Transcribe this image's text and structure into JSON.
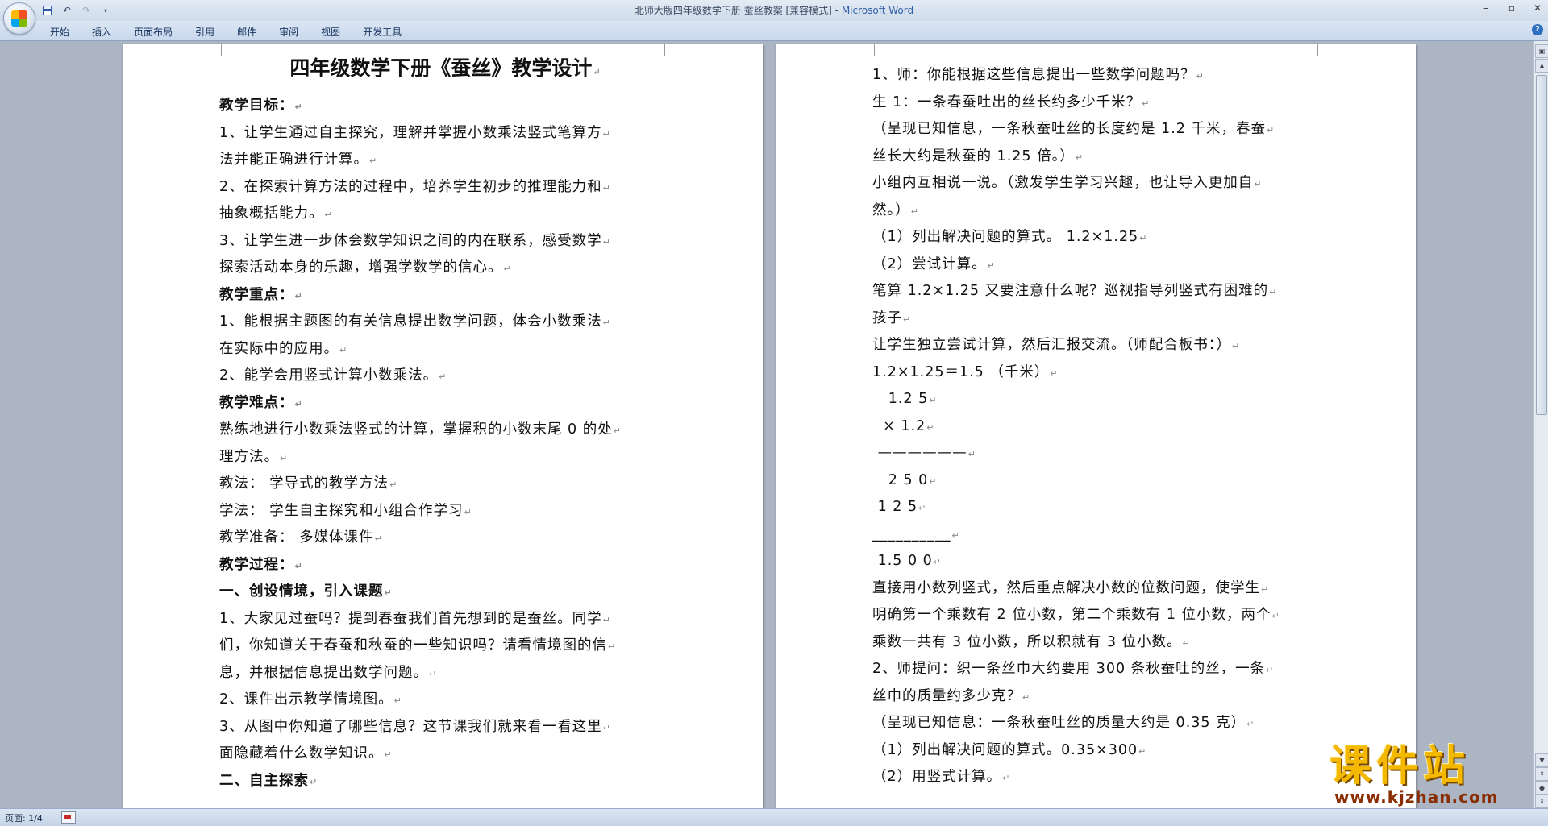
{
  "window": {
    "title": "北师大版四年级数学下册  蚕丝教案 [兼容模式] - ",
    "app_name": "Microsoft Word"
  },
  "qat": {
    "save_icon": "save-icon",
    "undo_icon": "undo-icon",
    "redo_icon": "redo-icon",
    "customize_icon": "dropdown-icon"
  },
  "ribbon": {
    "tabs": [
      "开始",
      "插入",
      "页面布局",
      "引用",
      "邮件",
      "审阅",
      "视图",
      "开发工具"
    ]
  },
  "document": {
    "title": "四年级数学下册《蚕丝》教学设计",
    "left_page": [
      {
        "text": "教学目标：",
        "bold": true
      },
      {
        "text": "1、让学生通过自主探究，理解并掌握小数乘法竖式笔算方"
      },
      {
        "text": "法并能正确进行计算。"
      },
      {
        "text": "2、在探索计算方法的过程中，培养学生初步的推理能力和"
      },
      {
        "text": "抽象概括能力。"
      },
      {
        "text": "3、让学生进一步体会数学知识之间的内在联系，感受数学"
      },
      {
        "text": "探索活动本身的乐趣，增强学数学的信心。"
      },
      {
        "text": "教学重点：",
        "bold": true
      },
      {
        "text": "1、能根据主题图的有关信息提出数学问题，体会小数乘法"
      },
      {
        "text": "在实际中的应用。"
      },
      {
        "text": "2、能学会用竖式计算小数乘法。"
      },
      {
        "text": "教学难点：",
        "bold": true
      },
      {
        "text": "熟练地进行小数乘法竖式的计算，掌握积的小数末尾 0 的处"
      },
      {
        "text": "理方法。"
      },
      {
        "text": "教法： 学导式的教学方法"
      },
      {
        "text": "学法： 学生自主探究和小组合作学习"
      },
      {
        "text": "教学准备： 多媒体课件"
      },
      {
        "text": "教学过程：",
        "bold": true
      },
      {
        "text": "一、创设情境，引入课题",
        "bold": true
      },
      {
        "text": "1、大家见过蚕吗？提到春蚕我们首先想到的是蚕丝。同学"
      },
      {
        "text": "们，你知道关于春蚕和秋蚕的一些知识吗？请看情境图的信"
      },
      {
        "text": "息，并根据信息提出数学问题。"
      },
      {
        "text": "2、课件出示教学情境图。"
      },
      {
        "text": "3、从图中你知道了哪些信息？这节课我们就来看一看这里"
      },
      {
        "text": "面隐藏着什么数学知识。"
      },
      {
        "text": "二、自主探索",
        "bold": true
      }
    ],
    "right_page": [
      {
        "text": "1、师：你能根据这些信息提出一些数学问题吗？"
      },
      {
        "text": "生 1：一条春蚕吐出的丝长约多少千米？"
      },
      {
        "text": "（呈现已知信息，一条秋蚕吐丝的长度约是 1.2 千米，春蚕"
      },
      {
        "text": "丝长大约是秋蚕的 1.25 倍。）"
      },
      {
        "text": "小组内互相说一说。（激发学生学习兴趣，也让导入更加自"
      },
      {
        "text": "然。）"
      },
      {
        "text": "（1）列出解决问题的算式。 1.2×1.25"
      },
      {
        "text": "（2）尝试计算。"
      },
      {
        "text": "笔算 1.2×1.25 又要注意什么呢？巡视指导列竖式有困难的"
      },
      {
        "text": "孩子"
      },
      {
        "text": "让学生独立尝试计算，然后汇报交流。（师配合板书：）"
      },
      {
        "text": "1.2×1.25＝1.5 （千米）"
      },
      {
        "text": "   1.2 5"
      },
      {
        "text": "  × 1.2"
      },
      {
        "text": " ——————"
      },
      {
        "text": "   2 5 0"
      },
      {
        "text": " 1 2 5"
      },
      {
        "text": "__________"
      },
      {
        "text": " 1.5 0 0"
      },
      {
        "text": "直接用小数列竖式，然后重点解决小数的位数问题，使学生"
      },
      {
        "text": "明确第一个乘数有 2 位小数，第二个乘数有 1 位小数，两个"
      },
      {
        "text": "乘数一共有 3 位小数，所以积就有 3 位小数。"
      },
      {
        "text": "2、师提问：织一条丝巾大约要用 300 条秋蚕吐的丝，一条"
      },
      {
        "text": "丝巾的质量约多少克？"
      },
      {
        "text": "（呈现已知信息：一条秋蚕吐丝的质量大约是 0.35 克）"
      },
      {
        "text": "（1）列出解决问题的算式。0.35×300"
      },
      {
        "text": "（2）用竖式计算。"
      }
    ]
  },
  "statusbar": {
    "page_info": "页面: 1/4"
  },
  "watermark": {
    "brand": "课件站",
    "url": "www.kjzhan.com"
  }
}
